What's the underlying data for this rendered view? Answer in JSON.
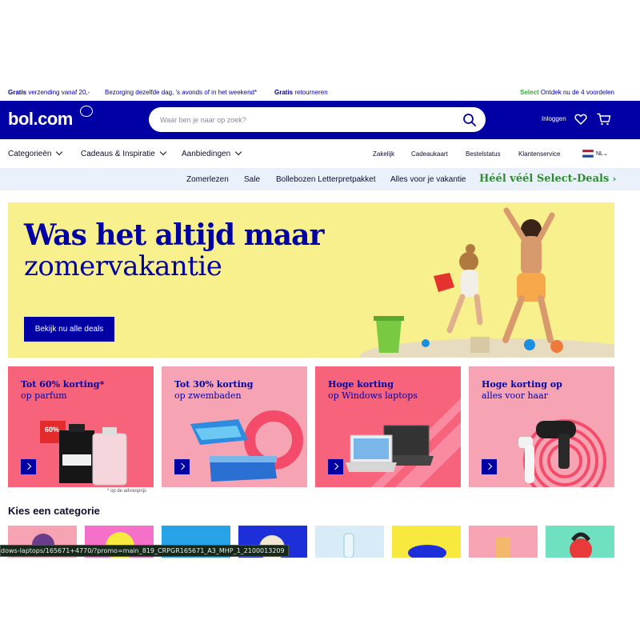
{
  "usp": {
    "shipping_bold": "Gratis",
    "shipping_rest": " verzending vanaf 20,-",
    "delivery": "Bezorging dezelfde dag, 's avonds of in het weekend*",
    "returns_bold": "Gratis",
    "returns_rest": " retourneren",
    "select_bold": "Select",
    "select_rest": " Ontdek nu de 4 voordelen"
  },
  "header": {
    "logo": "bol.com",
    "search_placeholder": "Waar ben je naar op zoek?",
    "login": "Inloggen",
    "brand_color": "#0000a4"
  },
  "nav": {
    "categories": "Categorieën",
    "gifts": "Cadeaus & Inspiratie",
    "offers": "Aanbiedingen",
    "business": "Zakelijk",
    "giftcard": "Cadeaukaart",
    "order_status": "Bestelstatus",
    "customer_service": "Klantenservice",
    "language": "NL"
  },
  "subnav": {
    "items": [
      "Zomerlezen",
      "Sale",
      "Bollebozen Letterpretpakket",
      "Alles voor je vakantie"
    ],
    "select_deals": "Héél véél Select-Deals"
  },
  "hero": {
    "title": "Was het altijd maar",
    "subtitle": "zomervakantie",
    "button": "Bekijk nu alle deals",
    "bg_color": "#f8f08c"
  },
  "tiles": [
    {
      "title": "Tot 60% korting*",
      "sub": "op parfum",
      "bg": "#f7637a",
      "badge": "60%"
    },
    {
      "title": "Tot 30% korting",
      "sub": "op zwembaden",
      "bg": "#f6a4b4"
    },
    {
      "title": "Hoge korting",
      "sub": "op Windows laptops",
      "bg": "#f7637a"
    },
    {
      "title": "Hoge korting op",
      "sub": "alles voor haar",
      "bg": "#f6a4b4"
    }
  ],
  "footnote": "* op de adviesprijs",
  "categories": {
    "title": "Kies een categorie",
    "tile_colors": [
      "#f6a4b4",
      "#f570c8",
      "#27a3e8",
      "#1d2fd9",
      "#d7ecf6",
      "#f8e93e",
      "#f6a4b4",
      "#6fe0c0"
    ]
  },
  "status_url": "dows-laptops/165671+4770/?promo=main_819_CRPGR165671_A3_MHP_1_2100013209"
}
